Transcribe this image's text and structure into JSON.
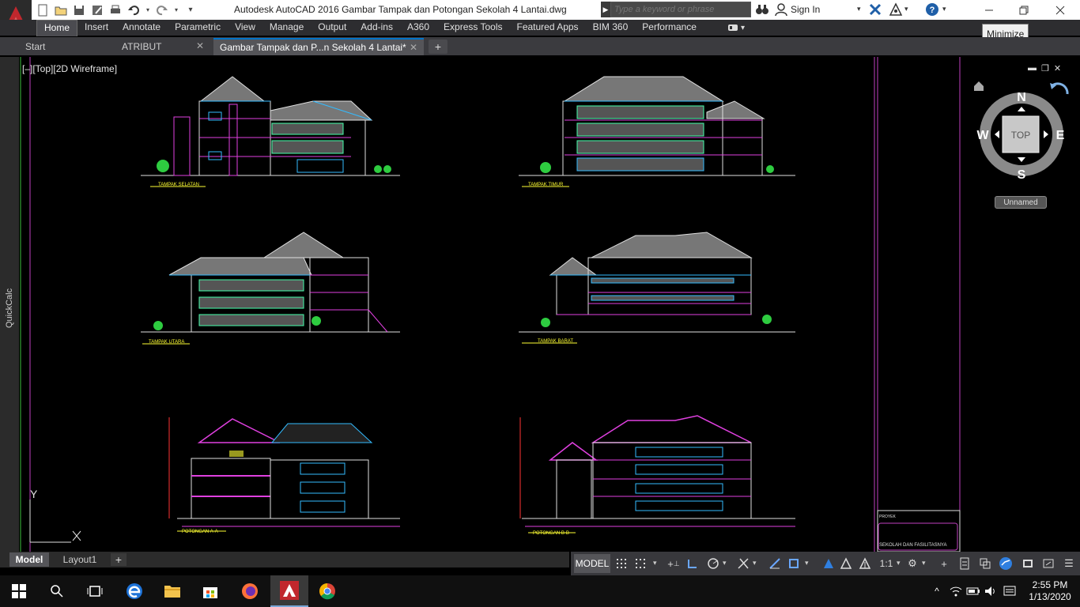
{
  "window": {
    "title": "Autodesk AutoCAD 2016    Gambar Tampak dan Potongan Sekolah 4 Lantai.dwg",
    "search_placeholder": "Type a keyword or phrase",
    "sign_in": "Sign In",
    "tooltip": "Minimize"
  },
  "ribbon": {
    "tabs": [
      "Home",
      "Insert",
      "Annotate",
      "Parametric",
      "View",
      "Manage",
      "Output",
      "Add-ins",
      "A360",
      "Express Tools",
      "Featured Apps",
      "BIM 360",
      "Performance"
    ]
  },
  "doc_tabs": {
    "start": "Start",
    "atribut": "ATRIBUT",
    "current": "Gambar Tampak dan P...n Sekolah 4 Lantai*"
  },
  "drawing": {
    "viewport_label": "[–][Top][2D Wireframe]",
    "quickcalc": "QuickCalc",
    "y_axis": "Y",
    "drawing_labels": [
      "TAMPAK SELATAN",
      "TAMPAK TIMUR",
      "TAMPAK UTARA",
      "TAMPAK BARAT",
      "POTONGAN A-A",
      "POTONGAN B-B"
    ],
    "title_block": {
      "proyek_label": "PROYEK",
      "proyek_value": "SEKOLAH DAN FASILITASNYA"
    }
  },
  "viewcube": {
    "north": "N",
    "south": "S",
    "east": "E",
    "west": "W",
    "face": "TOP",
    "ucs": "Unnamed"
  },
  "layout_tabs": {
    "model": "Model",
    "layout1": "Layout1"
  },
  "status": {
    "model": "MODEL",
    "scale": "1:1"
  },
  "taskbar": {
    "time": "2:55 PM",
    "date": "1/13/2020"
  },
  "colors": {
    "accent": "#0073c8",
    "autocad_red": "#c1272d",
    "canvas": "#000000"
  }
}
